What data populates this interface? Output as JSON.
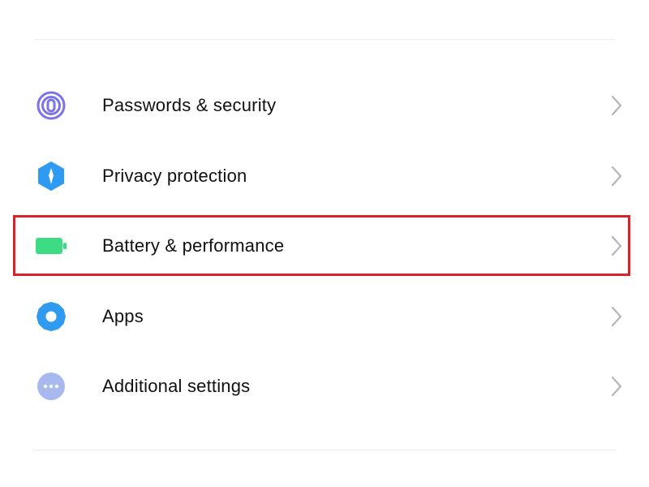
{
  "settings": {
    "items": [
      {
        "label": "Passwords & security",
        "icon": "fingerprint-icon",
        "icon_color": "#7b74e8"
      },
      {
        "label": "Privacy protection",
        "icon": "privacy-shield-icon",
        "icon_color": "#2f9bf0"
      },
      {
        "label": "Battery & performance",
        "icon": "battery-icon",
        "icon_color": "#3ddc84"
      },
      {
        "label": "Apps",
        "icon": "gear-icon",
        "icon_color": "#2f9bf0"
      },
      {
        "label": "Additional settings",
        "icon": "more-dots-icon",
        "icon_color": "#a7b9ee"
      }
    ]
  },
  "highlight": {
    "item": "Battery & performance",
    "color": "#d8232a"
  },
  "colors": {
    "chevron": "#b5b5b5",
    "divider": "#ececec",
    "text": "#111111"
  }
}
